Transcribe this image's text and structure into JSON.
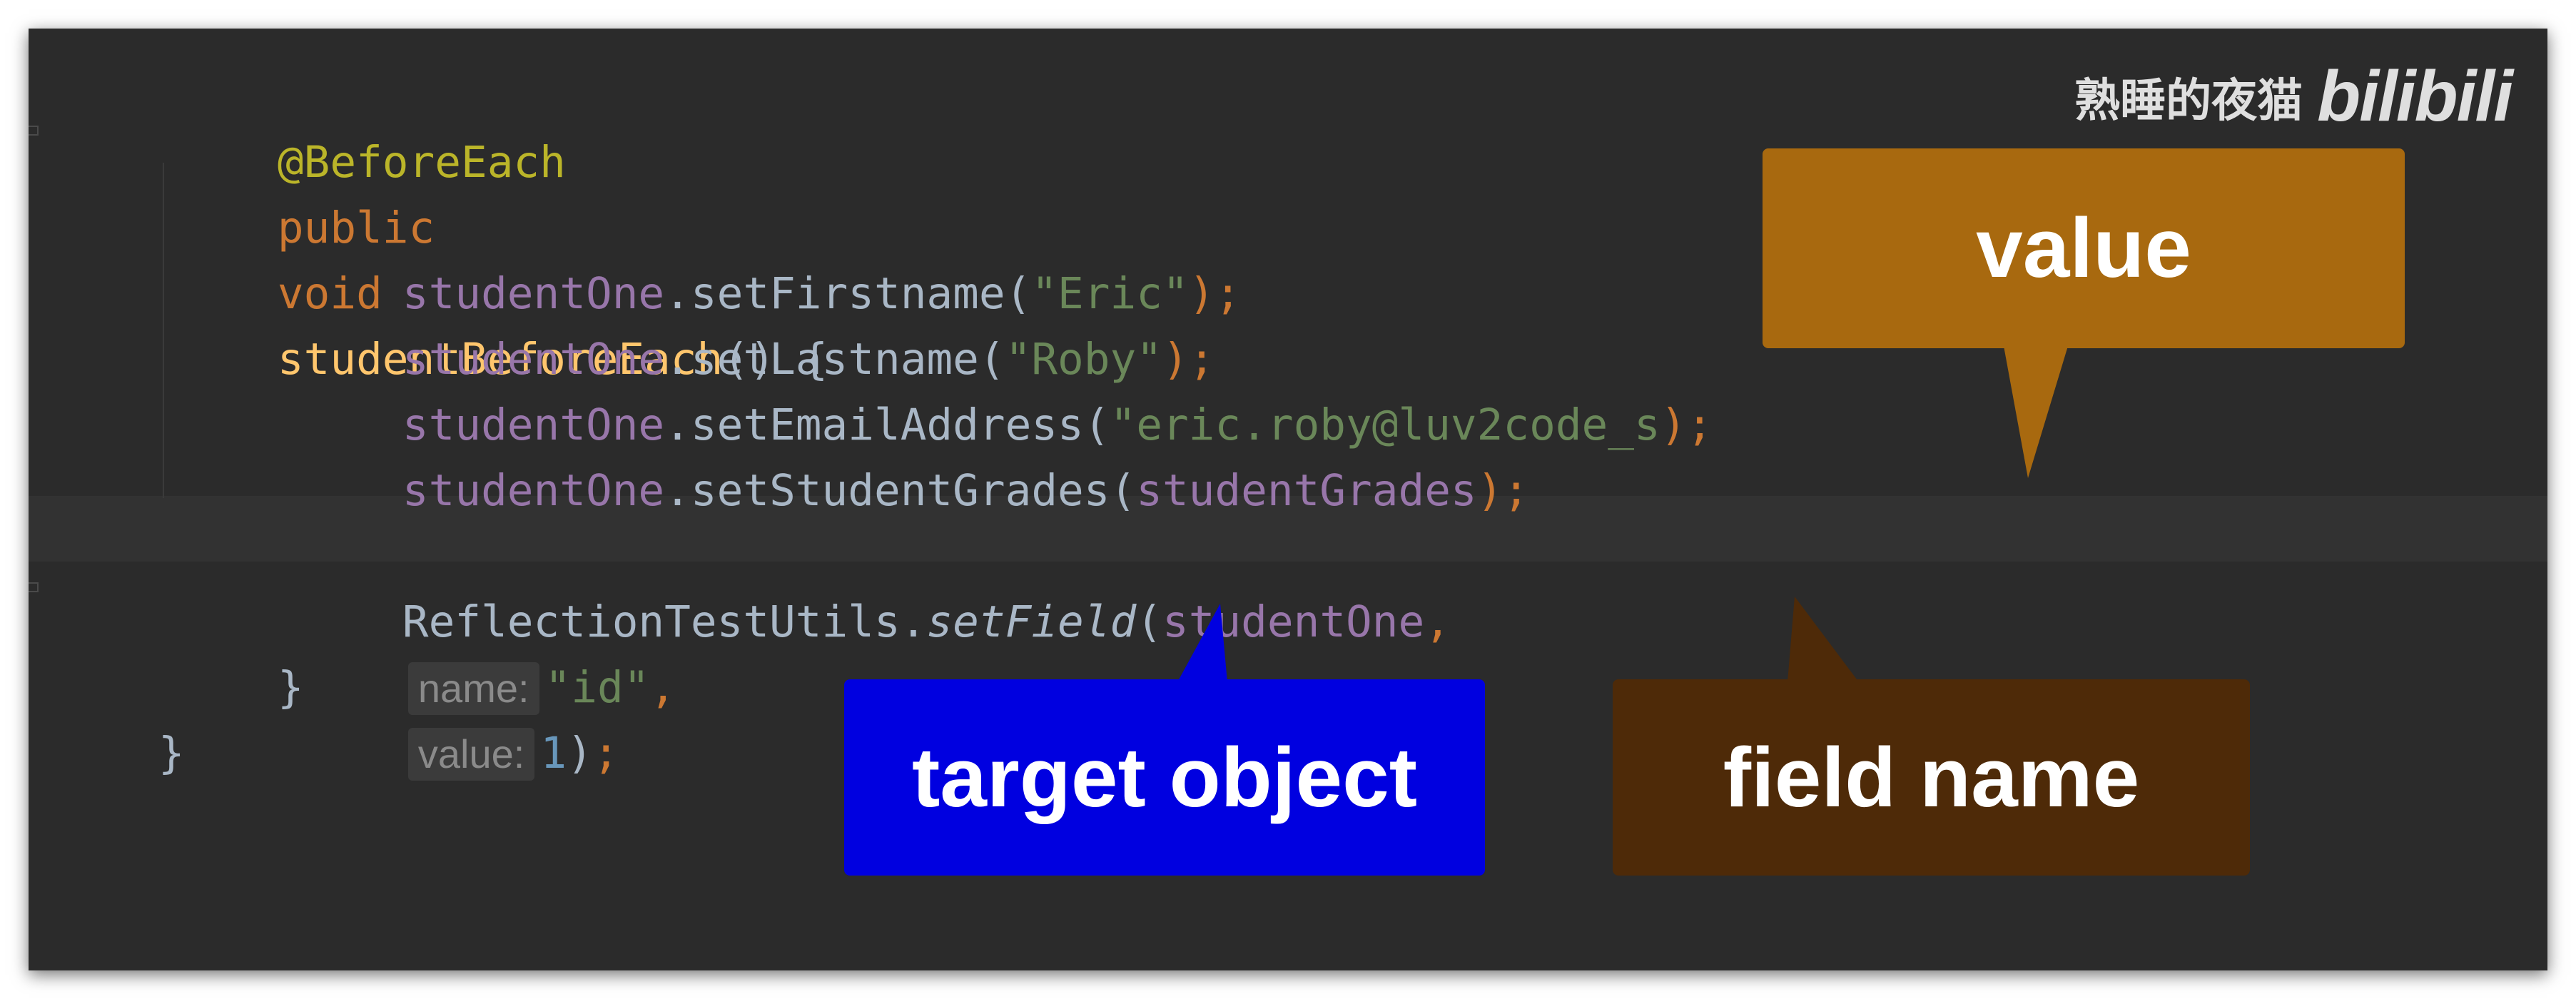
{
  "code": {
    "annotation": "@BeforeEach",
    "signature": {
      "kw1": "public",
      "kw2": "void",
      "method": "studentBeforeEach",
      "params": "() {"
    },
    "lines": [
      {
        "obj": "studentOne",
        "call": ".setFirstname(",
        "arg": "\"Eric\"",
        "end": ");"
      },
      {
        "obj": "studentOne",
        "call": ".setLastname(",
        "arg": "\"Roby\"",
        "end": ");"
      },
      {
        "obj": "studentOne",
        "call": ".setEmailAddress(",
        "arg": "\"eric.roby@luv2code_s",
        "end": ");"
      },
      {
        "obj": "studentOne",
        "call": ".setStudentGrades(",
        "arg": "studentGrades",
        "end": ");"
      }
    ],
    "reflection": {
      "cls": "ReflectionTestUtils.",
      "method": "setField",
      "open": "(",
      "obj": "studentOne",
      "comma1": ",",
      "hint_name": "name:",
      "name_val": "\"id\"",
      "comma2": ",",
      "hint_value": "value:",
      "value_val": "1",
      "close": ")",
      "semi": ";"
    },
    "close_method": "}",
    "close_class": "}"
  },
  "watermark": {
    "text": "熟睡的夜猫",
    "logo": "bilibili"
  },
  "callouts": {
    "value": "value",
    "target": "target object",
    "field": "field name"
  },
  "colors": {
    "editor_bg": "#2b2b2b",
    "value_bubble": "#a8690f",
    "target_bubble": "#0000e0",
    "field_bubble": "#4e2a08"
  }
}
